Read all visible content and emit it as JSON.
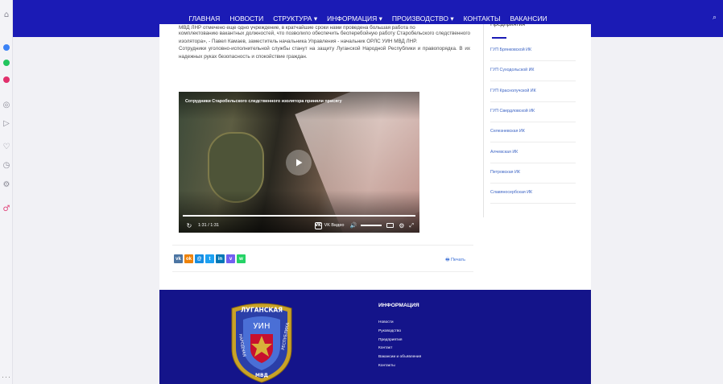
{
  "browser_sidebar": {
    "icons": [
      {
        "name": "home-icon",
        "glyph": "⌂",
        "color": "#8a8a96"
      },
      {
        "name": "messenger-icon",
        "glyph": "",
        "color": "#3b82f6"
      },
      {
        "name": "whatsapp-icon",
        "glyph": "",
        "color": "#22c55e"
      },
      {
        "name": "instagram-icon",
        "glyph": "",
        "color": "#e1306c"
      },
      {
        "name": "player-icon",
        "glyph": "◎",
        "color": "#8a8a96"
      },
      {
        "name": "send-icon",
        "glyph": "▷",
        "color": "#8a8a96"
      },
      {
        "name": "heart-icon",
        "glyph": "♡",
        "color": "#8a8a96"
      },
      {
        "name": "history-icon",
        "glyph": "◷",
        "color": "#8a8a96"
      },
      {
        "name": "settings-icon",
        "glyph": "⚙",
        "color": "#8a8a96"
      },
      {
        "name": "pin-icon",
        "glyph": "♂",
        "color": "#e0457b"
      }
    ],
    "more_label": "···"
  },
  "nav": {
    "items": [
      "ГЛАВНАЯ",
      "НОВОСТИ",
      "СТРУКТУРА ▾",
      "ИНФОРМАЦИЯ ▾",
      "ПРОИЗВОДСТВО ▾",
      "КОНТАКТЫ",
      "ВАКАНСИИ"
    ],
    "search_icon": "⌕"
  },
  "article": {
    "clipped_line": "МВД ЛНР отмечено еще одно учреждение, в кратчайшие сроки нами проведена большая работа по",
    "paragraph1": "комплектованию вакантных должностей, что позволило обеспечить бесперебойную работу Старобельского следственного изолятора», - Павел Камаев, заместитель начальника Управления - начальник ОРЛС УИН МВД ЛНР.",
    "paragraph2": "Сотрудники уголовно-исполнительной службы станут на защиту Луганской Народной Республики и правопорядка. В их надежных руках безопасность и спокойствие граждан."
  },
  "video": {
    "title": "Сотрудники Старобельского следственного изолятора приняли присягу",
    "time": "1:31 / 1:31",
    "progress": 1.0,
    "brand_logo": "VK",
    "brand_label": "VK Видео"
  },
  "share": {
    "buttons": [
      {
        "name": "share-vk-button",
        "label": "vk",
        "color": "#4c75a3"
      },
      {
        "name": "share-ok-button",
        "label": "ok",
        "color": "#ee8208"
      },
      {
        "name": "share-mail-button",
        "label": "@",
        "color": "#168de2"
      },
      {
        "name": "share-twitter-button",
        "label": "t",
        "color": "#1da1f2"
      },
      {
        "name": "share-linkedin-button",
        "label": "in",
        "color": "#0077b5"
      },
      {
        "name": "share-viber-button",
        "label": "v",
        "color": "#7360f2"
      },
      {
        "name": "share-whatsapp-button",
        "label": "w",
        "color": "#25d366"
      }
    ],
    "print_label": "🖶 Печать"
  },
  "sidebar": {
    "heading_clipped": "Предприятия",
    "items": [
      "ГУП Брянковской ИК",
      "ГУП Суходольской ИК",
      "ГУП Краснолучской ИК",
      "ГУП Свердловской ИК",
      "Селезневская ИК",
      "Алчевская ИК",
      "Петровская ИК",
      "Славяносербская ИК"
    ]
  },
  "footer": {
    "heading": "ИНФОРМАЦИЯ",
    "links": [
      "Новости",
      "Руководство",
      "Предприятия",
      "Контакт",
      "Вакансии и объявления",
      "Контакты"
    ],
    "emblem_text": {
      "top": "ЛУГАНСКАЯ",
      "center": "УИН",
      "left": "НАРОДНАЯ",
      "right": "РЕСПУБЛИКА",
      "bottom": "МВД"
    }
  },
  "colors": {
    "nav": "#1b1bb5",
    "footer": "#14148a",
    "link": "#3b63c4"
  }
}
